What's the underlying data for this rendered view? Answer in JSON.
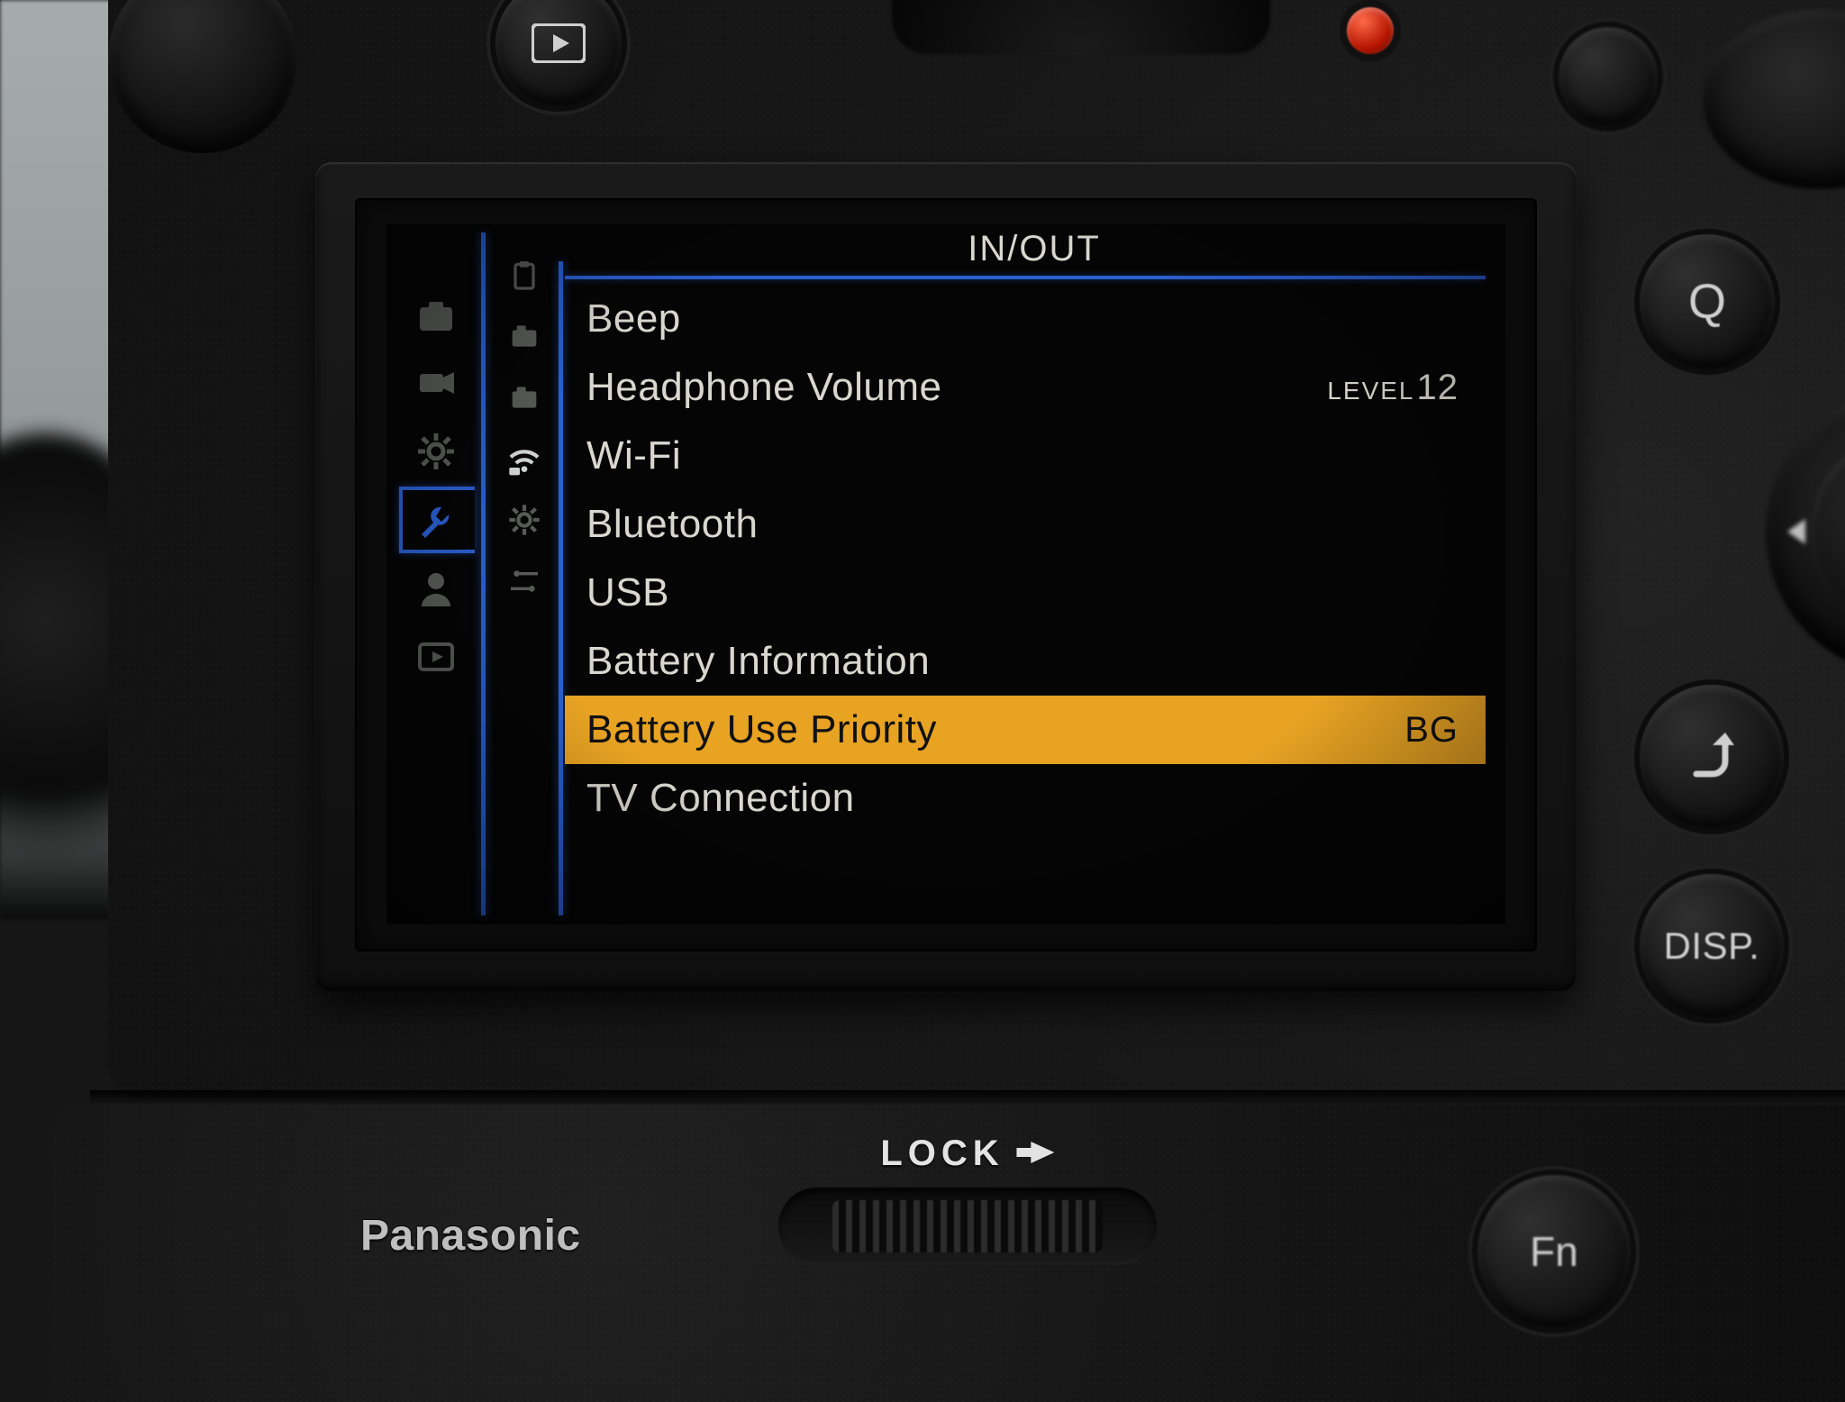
{
  "hardware": {
    "brand": "Panasonic",
    "lock_label": "LOCK",
    "buttons": {
      "q": "Q",
      "disp": "DISP.",
      "fn": "Fn"
    }
  },
  "menu": {
    "title": "IN/OUT",
    "primary_tabs": [
      {
        "id": "photo-tab",
        "icon": "camera"
      },
      {
        "id": "video-tab",
        "icon": "video"
      },
      {
        "id": "custom-tab",
        "icon": "gear"
      },
      {
        "id": "setup-tab",
        "icon": "wrench",
        "selected": true
      },
      {
        "id": "mymenu-tab",
        "icon": "user"
      },
      {
        "id": "playback-tab",
        "icon": "play"
      }
    ],
    "secondary_tabs": [
      {
        "id": "card-tab",
        "icon": "clipboard"
      },
      {
        "id": "monitor1-tab",
        "icon": "cam-body"
      },
      {
        "id": "monitor2-tab",
        "icon": "cam-body"
      },
      {
        "id": "inout-tab",
        "icon": "wifi",
        "selected": true
      },
      {
        "id": "setting-tab",
        "icon": "gear"
      },
      {
        "id": "others-tab",
        "icon": "sliders"
      }
    ],
    "items": [
      {
        "label": "Beep",
        "value": ""
      },
      {
        "label": "Headphone Volume",
        "value_prefix": "LEVEL",
        "value": "12"
      },
      {
        "label": "Wi-Fi",
        "value": ""
      },
      {
        "label": "Bluetooth",
        "value": ""
      },
      {
        "label": "USB",
        "value": ""
      },
      {
        "label": "Battery Information",
        "value": ""
      },
      {
        "label": "Battery Use Priority",
        "value": "BG",
        "highlight": true
      },
      {
        "label": "TV Connection",
        "value": ""
      }
    ]
  }
}
